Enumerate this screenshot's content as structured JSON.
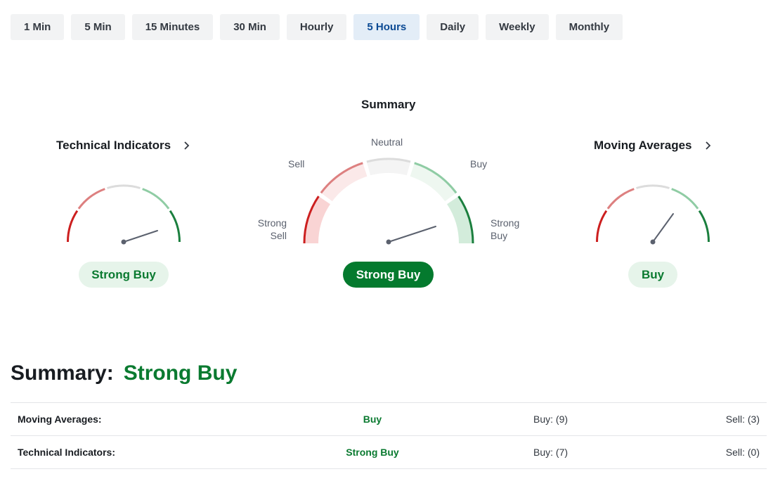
{
  "timeframes": {
    "items": [
      {
        "label": "1 Min",
        "active": false
      },
      {
        "label": "5 Min",
        "active": false
      },
      {
        "label": "15 Minutes",
        "active": false
      },
      {
        "label": "30 Min",
        "active": false
      },
      {
        "label": "Hourly",
        "active": false
      },
      {
        "label": "5 Hours",
        "active": true
      },
      {
        "label": "Daily",
        "active": false
      },
      {
        "label": "Weekly",
        "active": false
      },
      {
        "label": "Monthly",
        "active": false
      }
    ]
  },
  "gauges": {
    "summary_heading": "Summary",
    "scale_labels": {
      "strong_sell": "Strong Sell",
      "sell": "Sell",
      "neutral": "Neutral",
      "buy": "Buy",
      "strong_buy": "Strong Buy"
    },
    "technical": {
      "title": "Technical Indicators",
      "chevron": "chevron-right-icon",
      "result": "Strong Buy"
    },
    "summary": {
      "result": "Strong Buy"
    },
    "moving_averages": {
      "title": "Moving Averages",
      "chevron": "chevron-right-icon",
      "result": "Buy"
    }
  },
  "summary": {
    "label": "Summary:",
    "value": "Strong Buy",
    "rows": [
      {
        "name": "Moving Averages:",
        "signal": "Buy",
        "buy": "Buy: (9)",
        "sell": "Sell: (3)"
      },
      {
        "name": "Technical Indicators:",
        "signal": "Strong Buy",
        "buy": "Buy: (7)",
        "sell": "Sell: (0)"
      }
    ]
  },
  "colors": {
    "strong_sell": "#cc1f1f",
    "sell": "#dd8080",
    "neutral": "#dcdcdc",
    "buy": "#8fcca4",
    "strong_buy": "#1b7f3e",
    "active_tab_bg": "#e3edf7",
    "positive_text": "#0a7a30"
  }
}
